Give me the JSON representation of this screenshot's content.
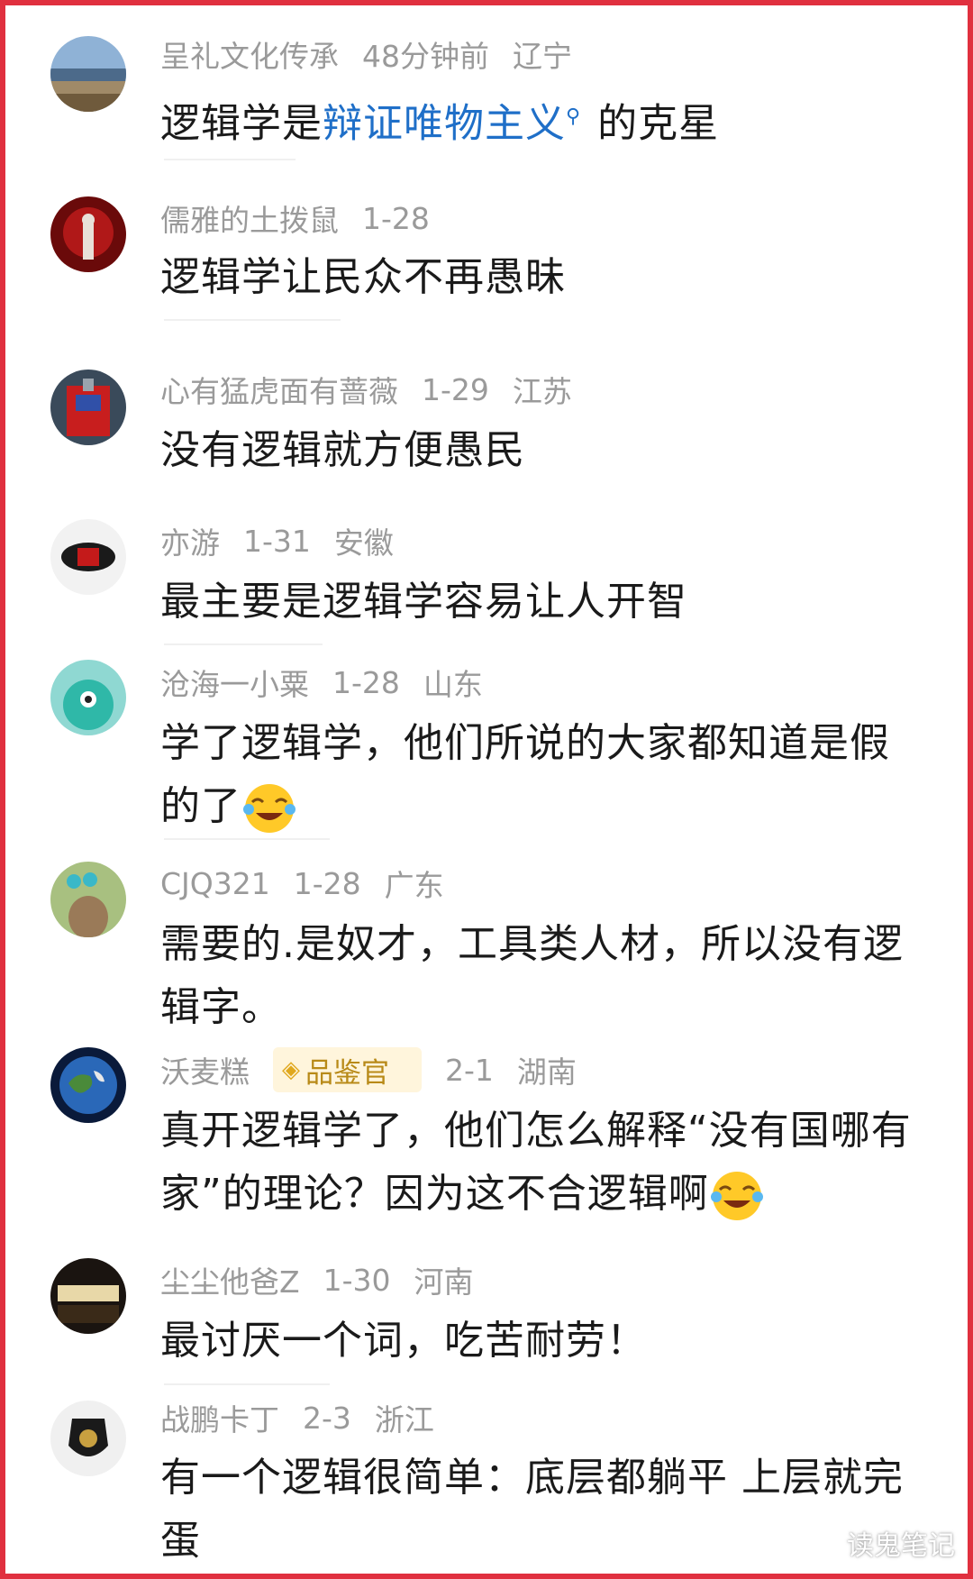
{
  "comments": [
    {
      "user": "呈礼文化传承",
      "time": "48分钟前",
      "location": "辽宁",
      "text_before": "逻辑学是",
      "link_text": "辩证唯物主义",
      "link_icon": "search-icon",
      "text_after": "的克星"
    },
    {
      "user": "儒雅的土拨鼠",
      "time": "1-28",
      "location": "",
      "text": "逻辑学让民众不再愚昧"
    },
    {
      "user": "心有猛虎面有蔷薇",
      "time": "1-29",
      "location": "江苏",
      "text": "没有逻辑就方便愚民"
    },
    {
      "user": "亦游",
      "time": "1-31",
      "location": "安徽",
      "text": "最主要是逻辑学容易让人开智"
    },
    {
      "user": "沧海一小粟",
      "time": "1-28",
      "location": "山东",
      "text": "学了逻辑学，他们所说的大家都知道是假的了",
      "emoji": "laughing-crying-emoji"
    },
    {
      "user": "CJQ321",
      "time": "1-28",
      "location": "广东",
      "text": "需要的.是奴才，工具类人材，所以没有逻辑字。"
    },
    {
      "user": "沃麦糕",
      "badge": "品鉴官",
      "time": "2-1",
      "location": "湖南",
      "text": "真开逻辑学了，他们怎么解释“没有国哪有家”的理论？因为这不合逻辑啊",
      "emoji": "laughing-crying-emoji"
    },
    {
      "user": "尘尘他爸Z",
      "time": "1-30",
      "location": "河南",
      "text": "最讨厌一个词，吃苦耐劳！"
    },
    {
      "user": "战鹏卡丁",
      "time": "2-3",
      "location": "浙江",
      "text": "有一个逻辑很简单：底层都躺平 上层就完蛋"
    }
  ],
  "watermark": "读鬼笔记",
  "colors": {
    "frame": "#e0303f",
    "link": "#1f6fc8",
    "meta": "#9a9a9a",
    "badge_bg": "#fff5dc",
    "badge_text": "#b88a18"
  }
}
